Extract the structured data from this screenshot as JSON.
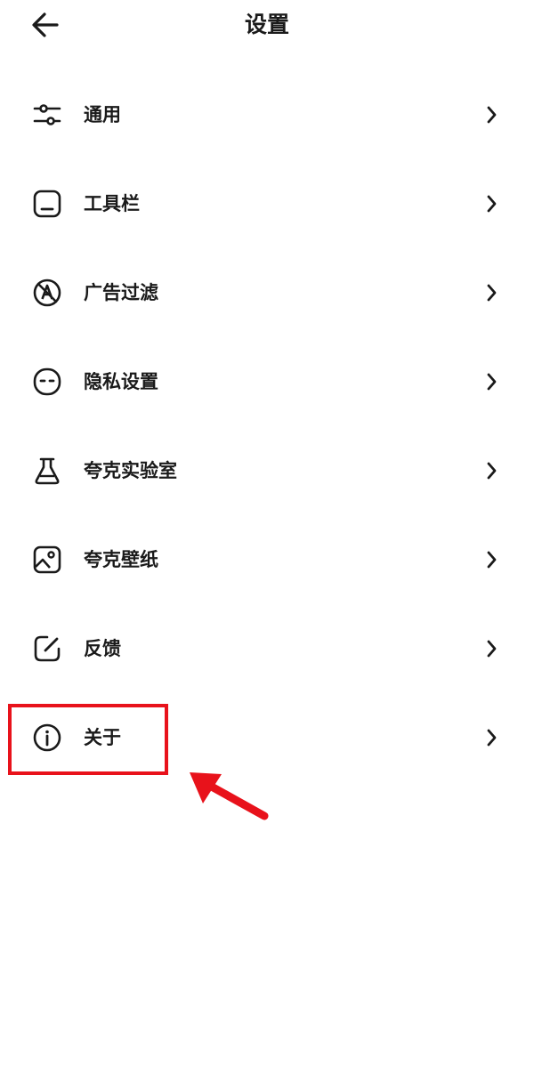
{
  "header": {
    "title": "设置",
    "back_icon": "arrow-left-icon"
  },
  "menu": {
    "items": [
      {
        "label": "通用",
        "icon": "sliders-icon"
      },
      {
        "label": "工具栏",
        "icon": "toolbar-icon"
      },
      {
        "label": "广告过滤",
        "icon": "ad-filter-icon"
      },
      {
        "label": "隐私设置",
        "icon": "privacy-icon"
      },
      {
        "label": "夸克实验室",
        "icon": "lab-flask-icon"
      },
      {
        "label": "夸克壁纸",
        "icon": "wallpaper-icon"
      },
      {
        "label": "反馈",
        "icon": "feedback-edit-icon"
      },
      {
        "label": "关于",
        "icon": "info-icon"
      }
    ],
    "chevron_icon": "chevron-right-icon"
  },
  "annotation": {
    "highlighted_item": "关于",
    "color": "#e8121b"
  }
}
